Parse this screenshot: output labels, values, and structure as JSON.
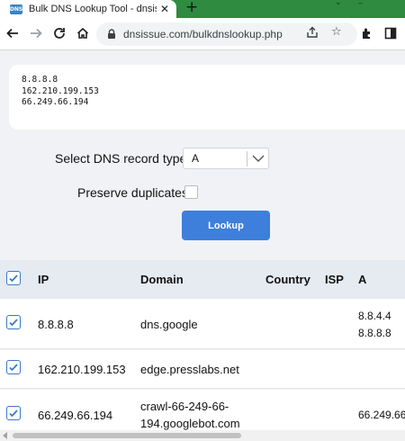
{
  "browser": {
    "tab_title": "Bulk DNS Lookup Tool - dnsissue",
    "favicon_text": "DNS",
    "url": "dnsissue.com/bulkdnslookup.php",
    "icons": [
      "back-icon",
      "forward-icon",
      "reload-icon",
      "home-icon",
      "lock-icon",
      "share-icon",
      "star-icon",
      "extensions-icon",
      "sidebar-icon"
    ]
  },
  "form": {
    "input_text": "8.8.8.8\n162.210.199.153\n66.249.66.194",
    "record_type_label": "Select DNS record type",
    "record_type_value": "A",
    "preserve_label": "Preserve duplicates",
    "preserve_checked": false,
    "lookup_button": "Lookup"
  },
  "table": {
    "headers": [
      "IP",
      "Domain",
      "Country",
      "ISP",
      "A"
    ],
    "rows": [
      {
        "checked": true,
        "ip": "8.8.8.8",
        "domain": "dns.google",
        "country": "",
        "isp": "",
        "a_line1": "8.8.4.4",
        "a_line2": "8.8.8.8"
      },
      {
        "checked": true,
        "ip": "162.210.199.153",
        "domain": "edge.presslabs.net",
        "country": "",
        "isp": "",
        "a_line1": "",
        "a_line2": ""
      },
      {
        "checked": true,
        "ip": "66.249.66.194",
        "domain_line1": "crawl-66-249-66-",
        "domain_line2": "194.googlebot.com",
        "country": "",
        "isp": "",
        "a_line1": "66.249.66"
      }
    ]
  },
  "colors": {
    "tabstrip": "#2e8b3f",
    "button": "#3d7fdb",
    "checkbox": "#3c78c8",
    "page_bg": "#f0f2f5"
  }
}
